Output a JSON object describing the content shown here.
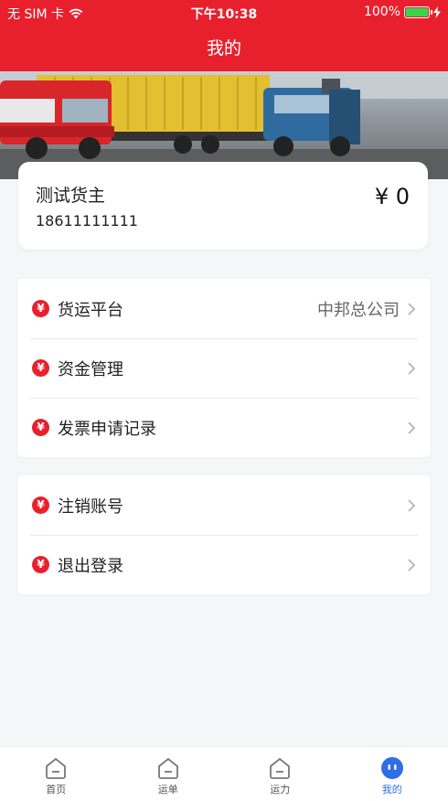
{
  "status_bar": {
    "carrier": "无 SIM 卡",
    "time": "下午10:38",
    "battery_percent": "100%"
  },
  "header": {
    "title": "我的"
  },
  "user": {
    "name": "测试货主",
    "phone": "18611111111",
    "balance": "¥ 0"
  },
  "menu_group_1": [
    {
      "label": "货运平台",
      "value": "中邦总公司",
      "icon": "yen-icon"
    },
    {
      "label": "资金管理",
      "value": "",
      "icon": "yen-icon"
    },
    {
      "label": "发票申请记录",
      "value": "",
      "icon": "yen-icon"
    }
  ],
  "menu_group_2": [
    {
      "label": "注销账号",
      "value": "",
      "icon": "yen-icon"
    },
    {
      "label": "退出登录",
      "value": "",
      "icon": "yen-icon"
    }
  ],
  "menu_icon_glyph": "¥",
  "tabs": [
    {
      "label": "首页",
      "icon": "home-icon",
      "active": false
    },
    {
      "label": "运单",
      "icon": "home-icon",
      "active": false
    },
    {
      "label": "运力",
      "icon": "home-icon",
      "active": false
    },
    {
      "label": "我的",
      "icon": "profile-icon",
      "active": true
    }
  ],
  "colors": {
    "brand_red": "#e8202d",
    "tab_active": "#2f6fe4",
    "battery_green": "#3fd34a"
  }
}
